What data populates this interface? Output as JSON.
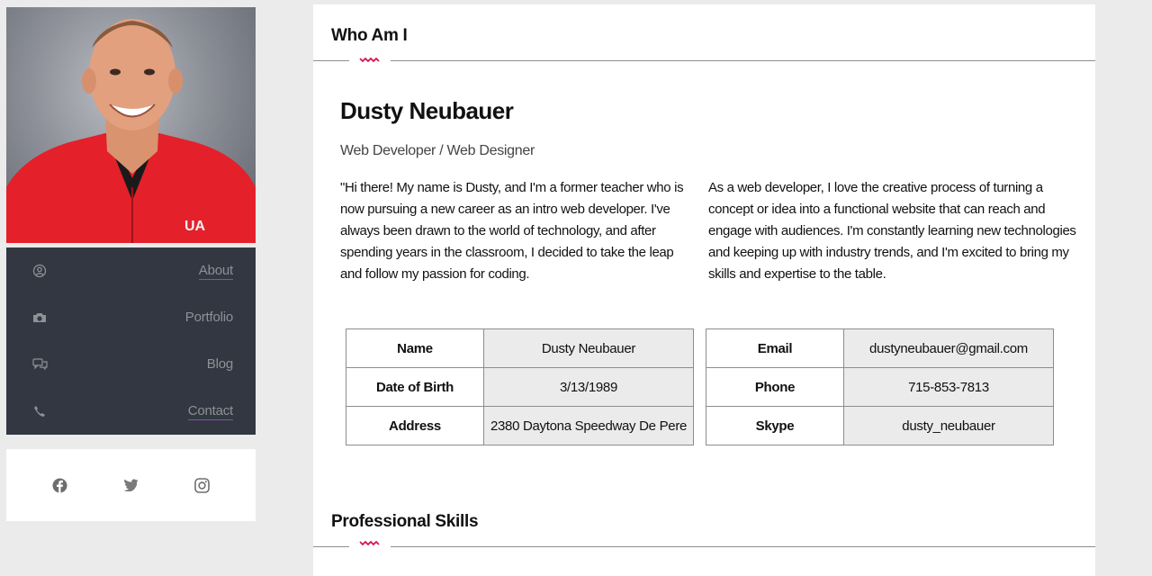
{
  "nav": {
    "items": [
      {
        "label": "About",
        "icon": "user-circle-icon"
      },
      {
        "label": "Portfolio",
        "icon": "camera-icon"
      },
      {
        "label": "Blog",
        "icon": "chat-bubbles-icon"
      },
      {
        "label": "Contact",
        "icon": "phone-icon"
      }
    ]
  },
  "social": [
    "facebook-icon",
    "twitter-icon",
    "instagram-icon"
  ],
  "about": {
    "section_title": "Who Am I",
    "name": "Dusty Neubauer",
    "role": "Web Developer / Web Designer",
    "paragraph1": "\"Hi there! My name is Dusty, and I'm a former teacher who is now pursuing a new career as an intro web developer. I've always been drawn to the world of technology, and after spending years in the classroom, I decided to take the leap and follow my passion for coding.",
    "paragraph2": "As a web developer, I love the creative process of turning a concept or idea into a functional website that can reach and engage with audiences. I'm constantly learning new technologies and keeping up with industry trends, and I'm excited to bring my skills and expertise to the table."
  },
  "info_left": [
    {
      "key": "Name",
      "value": "Dusty Neubauer"
    },
    {
      "key": "Date of Birth",
      "value": "3/13/1989"
    },
    {
      "key": "Address",
      "value": "2380 Daytona Speedway De Pere"
    }
  ],
  "info_right": [
    {
      "key": "Email",
      "value": "dustyneubauer@gmail.com"
    },
    {
      "key": "Phone",
      "value": "715-853-7813"
    },
    {
      "key": "Skype",
      "value": "dusty_neubauer"
    }
  ],
  "skills": {
    "section_title": "Professional Skills"
  },
  "colors": {
    "accent": "#d6164f",
    "sidebar": "#323741",
    "background": "#ebebeb"
  }
}
